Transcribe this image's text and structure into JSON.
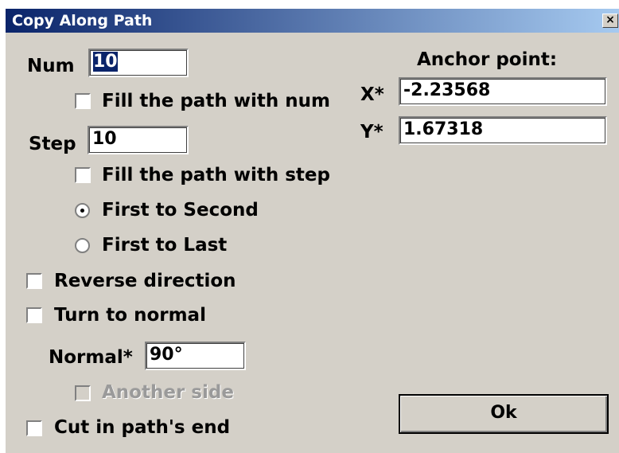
{
  "window": {
    "title": "Copy Along Path",
    "close_glyph": "×"
  },
  "num": {
    "label": "Num",
    "value": "10",
    "fill_label": "Fill the path with num",
    "fill_checked": false
  },
  "step": {
    "label": "Step",
    "value": "10",
    "fill_label": "Fill the path with step",
    "fill_checked": false
  },
  "step_mode": {
    "options": [
      "First to Second",
      "First to Last"
    ],
    "selected": "First to Second"
  },
  "reverse": {
    "label": "Reverse direction",
    "checked": false
  },
  "turn_normal": {
    "label": "Turn to normal",
    "checked": false
  },
  "normal": {
    "label": "Normal*",
    "value": "90°",
    "another_side_label": "Another side",
    "another_side_enabled": false
  },
  "cut": {
    "label": "Cut in path's end",
    "checked": false
  },
  "anchor": {
    "title": "Anchor point:",
    "x_label": "X*",
    "x_value": "-2.23568",
    "y_label": "Y*",
    "y_value": "1.67318"
  },
  "ok_button": {
    "label": "Ok"
  }
}
